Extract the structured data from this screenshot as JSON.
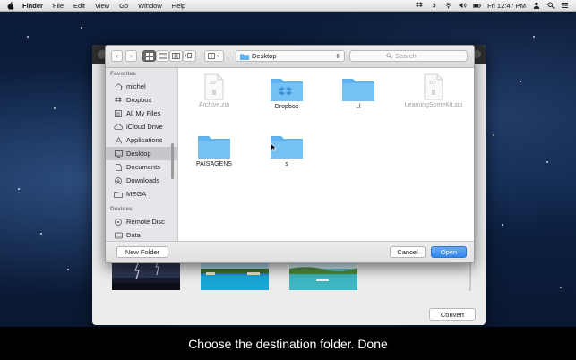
{
  "menubar": {
    "app_name": "Finder",
    "items": [
      "File",
      "Edit",
      "View",
      "Go",
      "Window",
      "Help"
    ],
    "clock": "Fri 12:47 PM",
    "status_icons": [
      "dropbox-icon",
      "bluetooth-icon",
      "wifi-icon",
      "volume-icon",
      "battery-icon",
      "user-icon",
      "spotlight-icon",
      "notification-icon"
    ]
  },
  "dialog": {
    "location": "Desktop",
    "search_placeholder": "Search",
    "sidebar": {
      "favorites_header": "Favorites",
      "favorites": [
        {
          "label": "michel",
          "icon": "home-icon"
        },
        {
          "label": "Dropbox",
          "icon": "dropbox-icon"
        },
        {
          "label": "All My Files",
          "icon": "all-files-icon"
        },
        {
          "label": "iCloud Drive",
          "icon": "cloud-icon"
        },
        {
          "label": "Applications",
          "icon": "applications-icon"
        },
        {
          "label": "Desktop",
          "icon": "desktop-icon"
        },
        {
          "label": "Documents",
          "icon": "documents-icon"
        },
        {
          "label": "Downloads",
          "icon": "downloads-icon"
        },
        {
          "label": "MEGA",
          "icon": "folder-icon"
        }
      ],
      "devices_header": "Devices",
      "devices": [
        {
          "label": "Remote Disc",
          "icon": "disc-icon"
        },
        {
          "label": "Data",
          "icon": "drive-icon"
        }
      ],
      "selected": "Desktop"
    },
    "files": [
      {
        "name": "Archive.zip",
        "kind": "zip",
        "dimmed": true
      },
      {
        "name": "Dropbox",
        "kind": "dropbox-folder",
        "dimmed": false
      },
      {
        "name": "i.l",
        "kind": "folder",
        "dimmed": false
      },
      {
        "name": "LearningSpriteKit.zip",
        "kind": "zip",
        "dimmed": true
      },
      {
        "name": "PAISAGENS",
        "kind": "folder",
        "dimmed": false
      },
      {
        "name": "s",
        "kind": "folder",
        "dimmed": false
      }
    ],
    "buttons": {
      "new_folder": "New Folder",
      "cancel": "Cancel",
      "open": "Open"
    }
  },
  "app": {
    "convert_label": "Convert"
  },
  "caption": "Choose the destination folder. Done",
  "colors": {
    "accent": "#2f86f0",
    "folder_blue": "#5fb3ee",
    "caption_bg": "#000000"
  }
}
